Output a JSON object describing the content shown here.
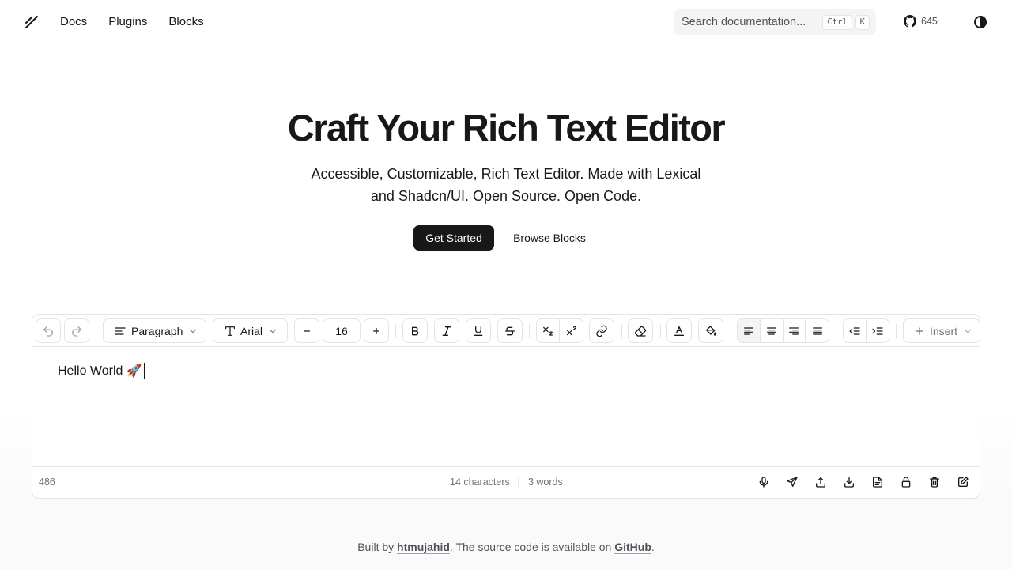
{
  "header": {
    "nav": [
      "Docs",
      "Plugins",
      "Blocks"
    ],
    "search_placeholder": "Search documentation...",
    "kbd": [
      "Ctrl",
      "K"
    ],
    "github_stars": "645"
  },
  "hero": {
    "title": "Craft Your Rich Text Editor",
    "subtitle": "Accessible, Customizable, Rich Text Editor. Made with Lexical and Shadcn/UI. Open Source. Open Code.",
    "primary_button": "Get Started",
    "secondary_button": "Browse Blocks"
  },
  "editor": {
    "block_type": "Paragraph",
    "font_family": "Arial",
    "font_size": "16",
    "insert_label": "Insert",
    "content": "Hello World 🚀",
    "footer": {
      "left_count": "486",
      "characters": "14 characters",
      "divider": "|",
      "words": "3 words"
    }
  },
  "credit": {
    "prefix": "Built by ",
    "author": "htmujahid",
    "middle": ". The source code is available on ",
    "link": "GitHub",
    "suffix": "."
  },
  "colors": {
    "primary": "#18181b",
    "border": "#e4e4e7",
    "muted": "#71717a"
  }
}
